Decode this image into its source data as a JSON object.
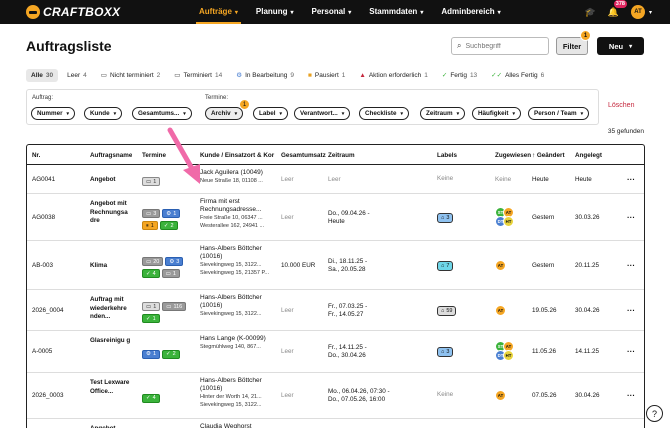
{
  "brand": {
    "name": "CRAFTBOXX"
  },
  "nav": [
    {
      "label": "Aufträge",
      "active": true
    },
    {
      "label": "Planung",
      "active": false
    },
    {
      "label": "Personal",
      "active": false
    },
    {
      "label": "Stammdaten",
      "active": false
    },
    {
      "label": "Adminbereich",
      "active": false
    }
  ],
  "topbar": {
    "notifications": "378",
    "user_initials": "AT"
  },
  "page": {
    "title": "Auftragsliste"
  },
  "search": {
    "placeholder": "Suchbegriff"
  },
  "buttons": {
    "filter": "Filter",
    "filter_count": "1",
    "new": "Neu"
  },
  "tabs": [
    {
      "label": "Alle",
      "count": "30",
      "active": true,
      "icon": ""
    },
    {
      "label": "Leer",
      "count": "4",
      "icon": ""
    },
    {
      "label": "Nicht terminiert",
      "count": "2",
      "icon": "▭"
    },
    {
      "label": "Terminiert",
      "count": "14",
      "icon": "▭"
    },
    {
      "label": "In Bearbeitung",
      "count": "9",
      "icon": "⚙"
    },
    {
      "label": "Pausiert",
      "count": "1",
      "icon": "■"
    },
    {
      "label": "Aktion erforderlich",
      "count": "1",
      "icon": "▲"
    },
    {
      "label": "Fertig",
      "count": "13",
      "icon": "✓"
    },
    {
      "label": "Alles Fertig",
      "count": "6",
      "icon": "✓✓"
    }
  ],
  "filters": {
    "auftrag_label": "Auftrag:",
    "termine_label": "Termine:",
    "termine_count": "1",
    "auftrag_chips": [
      "Nummer",
      "Kunde",
      "Gesamtums..."
    ],
    "termine_chips": [
      "Archiv",
      "Label",
      "Verantwort...",
      "Checkliste",
      "Zeitraum",
      "Häufigkeit",
      "Person / Team"
    ],
    "reset": "Löschen"
  },
  "results": {
    "found": "35 gefunden"
  },
  "table": {
    "columns": [
      "Nr.",
      "Auftragsname",
      "Termine",
      "Kunde / Einsatzort & Kor",
      "Gesamtumsatz",
      "Zeitraum",
      "Labels",
      "Zugewiesen",
      "↑ Geändert",
      "Angelegt"
    ],
    "rows": [
      {
        "nr": "AG0041",
        "name": "Angebot",
        "termine": [
          [
            "p-grey-l",
            "▭",
            "1"
          ]
        ],
        "kunde1": "Jack Aguilera (10049)",
        "kunde2": "Neue Straße 18, 01108 ...",
        "kunde3": "",
        "umsatz": "Leer",
        "zeit1": "Leer",
        "zeit2": "",
        "label": "Keine",
        "zugewiesen": "Keine",
        "geaendert": "Heute",
        "angelegt": "Heute"
      },
      {
        "nr": "AG0038",
        "name": "Angebot mit Rechnungsa dre",
        "termine": [
          [
            "p-grey",
            "▭",
            "3"
          ],
          [
            "p-blue",
            "⚙",
            "1"
          ],
          [
            "p-orange",
            "⏸",
            "1"
          ],
          [
            "p-green",
            "✓",
            "2"
          ]
        ],
        "kunde1": "Firma mit erst Rechnungsadresse...",
        "kunde2": "Freie Straße 10, 06347 ...",
        "kunde3": "Westerallee 162, 24941 ...",
        "umsatz": "Leer",
        "zeit1": "Do., 09.04.26 -",
        "zeit2": "Heute",
        "label": "3",
        "zugewiesen": "avatars4",
        "geaendert": "Gestern",
        "angelegt": "30.03.26"
      },
      {
        "nr": "AB-003",
        "name": "Klima",
        "termine": [
          [
            "p-grey",
            "▭",
            "20"
          ],
          [
            "p-blue",
            "⚙",
            "3"
          ],
          [
            "p-green",
            "✓",
            "4"
          ],
          [
            "p-grey",
            "▭",
            "1"
          ]
        ],
        "kunde1": "Hans-Albers Böttcher (10016)",
        "kunde2": "Sievekingweg 15, 3122...",
        "kunde3": "Sievekingweg 15, 21357 P...",
        "umsatz": "10.000 EUR",
        "zeit1": "Di., 18.11.25 -",
        "zeit2": "Sa., 20.05.28",
        "label": "7",
        "zugewiesen": "AT",
        "geaendert": "Gestern",
        "angelegt": "20.11.25"
      },
      {
        "nr": "2026_0004",
        "name": "Auftrag mit wiederkehre nden...",
        "termine": [
          [
            "p-grey-l",
            "▭",
            "1"
          ],
          [
            "p-grey",
            "▭",
            "116"
          ],
          [
            "p-green",
            "✓",
            "1"
          ]
        ],
        "kunde1": "Hans-Albers Böttcher (10016)",
        "kunde2": "Sievekingweg 15, 3122...",
        "kunde3": "",
        "umsatz": "Leer",
        "zeit1": "Fr., 07.03.25 -",
        "zeit2": "Fr., 14.05.27",
        "label": "59",
        "zugewiesen": "AT",
        "geaendert": "19.05.26",
        "angelegt": "30.04.26"
      },
      {
        "nr": "A-0005",
        "name": "Glasreinigu g",
        "termine": [
          [
            "p-blue",
            "⚙",
            "1"
          ],
          [
            "p-green",
            "✓",
            "2"
          ]
        ],
        "kunde1": "Hans Lange (K-00099)",
        "kunde2": "Stegmühlweg 140, 867...",
        "kunde3": "",
        "umsatz": "Leer",
        "zeit1": "Fr., 14.11.25 -",
        "zeit2": "Do., 30.04.26",
        "label": "3",
        "zugewiesen": "avatars4b",
        "geaendert": "11.05.26",
        "angelegt": "14.11.25"
      },
      {
        "nr": "2026_0003",
        "name": "Test Lexware Office...",
        "termine": [
          [
            "p-green",
            "✓",
            "4"
          ]
        ],
        "kunde1": "Hans-Albers Böttcher (10016)",
        "kunde2": "Hinter der Worth 14, 21...",
        "kunde3": "Sievekingweg 15, 3122...",
        "umsatz": "Leer",
        "zeit1": "Mo., 06.04.26, 07:30 -",
        "zeit2": "Do., 07.05.26, 16:00",
        "label": "Keine",
        "zugewiesen": "AT",
        "geaendert": "07.05.26",
        "angelegt": "30.04.26"
      },
      {
        "nr": "",
        "name": "Angebot",
        "termine": [],
        "kunde1": "Claudia Weghorst",
        "kunde2": "",
        "kunde3": "",
        "umsatz": "",
        "zeit1": "",
        "zeit2": "",
        "label": "",
        "zugewiesen": "",
        "geaendert": "",
        "angelegt": ""
      }
    ]
  }
}
